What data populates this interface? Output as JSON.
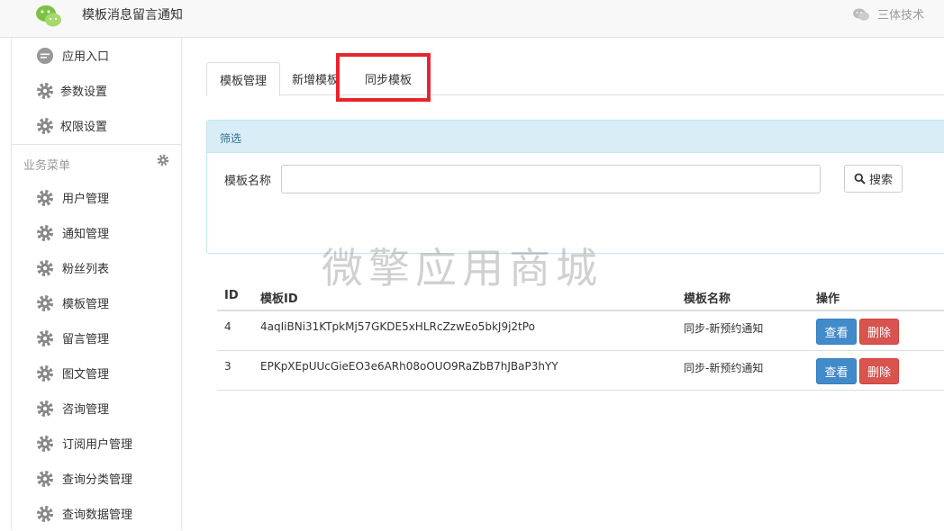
{
  "header": {
    "app_title": "模板消息留言通知",
    "account_name": "三体技术",
    "logo_icon": "wechat-logo",
    "account_icon": "wechat-icon"
  },
  "sidebar": {
    "top_items": [
      {
        "label": "应用入口",
        "icon": "chat-icon"
      },
      {
        "label": "参数设置",
        "icon": "gear-icon"
      },
      {
        "label": "权限设置",
        "icon": "gear-icon"
      }
    ],
    "section_label": "业务菜单",
    "section_icon": "gear-icon",
    "items": [
      {
        "label": "用户管理",
        "icon": "gear-icon"
      },
      {
        "label": "通知管理",
        "icon": "gear-icon"
      },
      {
        "label": "粉丝列表",
        "icon": "gear-icon"
      },
      {
        "label": "模板管理",
        "icon": "gear-icon"
      },
      {
        "label": "留言管理",
        "icon": "gear-icon"
      },
      {
        "label": "图文管理",
        "icon": "gear-icon"
      },
      {
        "label": "咨询管理",
        "icon": "gear-icon"
      },
      {
        "label": "订阅用户管理",
        "icon": "gear-icon"
      },
      {
        "label": "查询分类管理",
        "icon": "gear-icon"
      },
      {
        "label": "查询数据管理",
        "icon": "gear-icon"
      }
    ]
  },
  "tabs": [
    {
      "label": "模板管理",
      "active": true
    },
    {
      "label": "新增模板",
      "active": false
    },
    {
      "label": "同步模板",
      "active": false
    }
  ],
  "filter": {
    "heading": "筛选",
    "name_label": "模板名称",
    "name_value": "",
    "search_label": "搜索",
    "search_icon": "search-icon"
  },
  "watermark": "微擎应用商城",
  "table": {
    "headers": [
      "ID",
      "模板ID",
      "模板名称",
      "操作"
    ],
    "rows": [
      {
        "id": "4",
        "template_id": "4aqIiBNi31KTpkMj57GKDE5xHLRcZzwEo5bkJ9j2tPo",
        "name": "同步-新预约通知",
        "view": "查看",
        "delete": "删除"
      },
      {
        "id": "3",
        "template_id": "EPKpXEpUUcGieEO3e6ARh08oOUO9RaZbB7hJBaP3hYY",
        "name": "同步-新预约通知",
        "view": "查看",
        "delete": "删除"
      }
    ]
  },
  "colors": {
    "highlight": "#e8252c",
    "primary": "#428bca",
    "danger": "#d9534f",
    "info_bg": "#d9edf7"
  }
}
